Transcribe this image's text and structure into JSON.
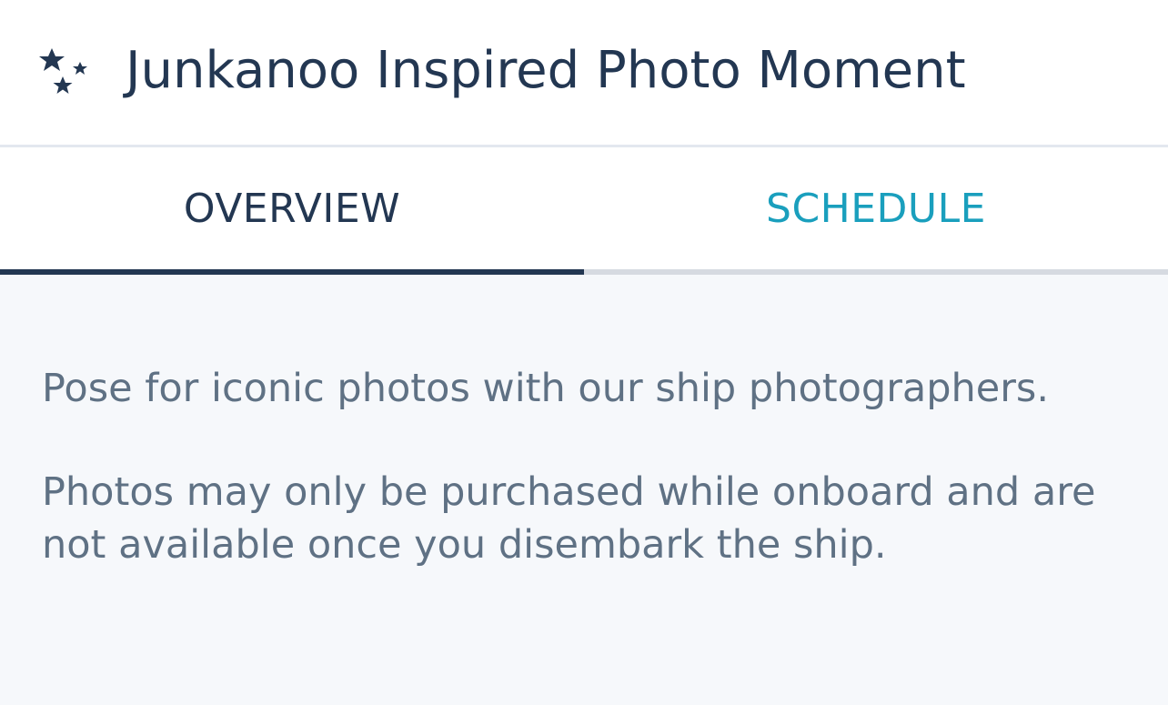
{
  "header": {
    "icon": "stars-icon",
    "title": "Junkanoo Inspired Photo Moment"
  },
  "tabs": [
    {
      "label": "OVERVIEW",
      "selected": true
    },
    {
      "label": "SCHEDULE",
      "selected": false
    }
  ],
  "content": {
    "paragraphs": [
      "Pose for iconic photos with our ship photographers.",
      "Photos may only be purchased while onboard and are not available once you disembark the ship."
    ]
  },
  "colors": {
    "title": "#233752",
    "active_tab": "#233752",
    "inactive_tab": "#1a9fbd",
    "body_text": "#5f7184",
    "background": "#f6f8fb"
  }
}
